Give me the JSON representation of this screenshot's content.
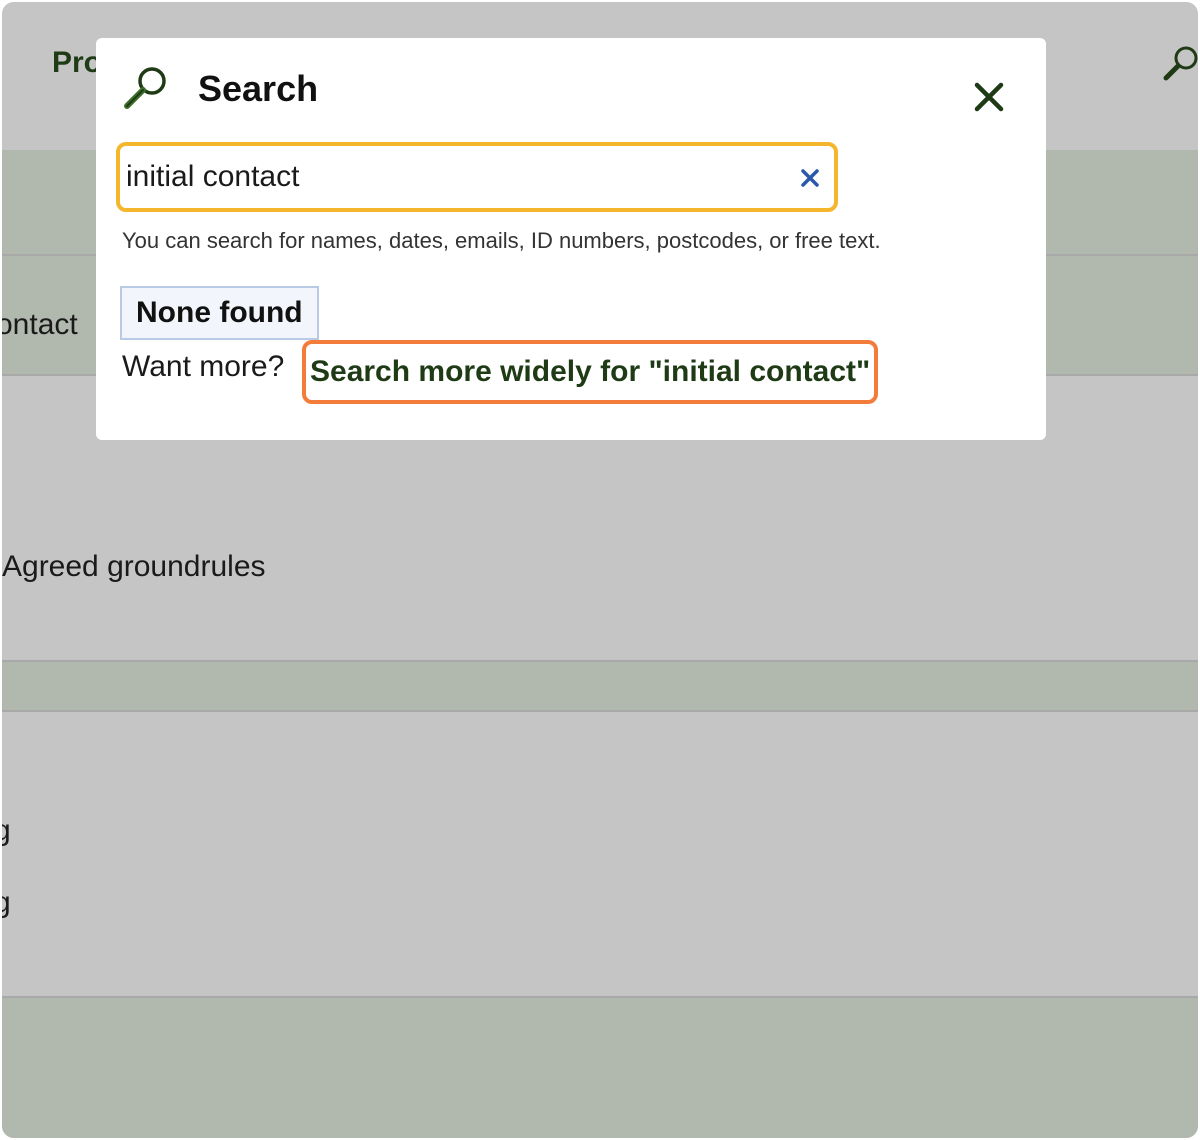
{
  "background": {
    "nav_label": "Pro",
    "row_contact": "ontact",
    "row_agreed": "Agreed groundrules",
    "row_g1": "g",
    "row_g2": "g"
  },
  "modal": {
    "title": "Search",
    "icon": "magnifier-icon",
    "close_icon": "close-icon",
    "search": {
      "value": "initial contact",
      "clear_icon": "clear-icon"
    },
    "hint": "You can search for names, dates, emails, ID numbers, postcodes, or free text.",
    "result_label": "None found",
    "want_more": "Want more?",
    "wider_link": "Search more widely for \"initial contact\""
  },
  "colors": {
    "accent_green": "#1f3b16",
    "focus_yellow": "#f4b62d",
    "highlight_orange": "#f47c3a",
    "clear_blue": "#2b58a8"
  }
}
